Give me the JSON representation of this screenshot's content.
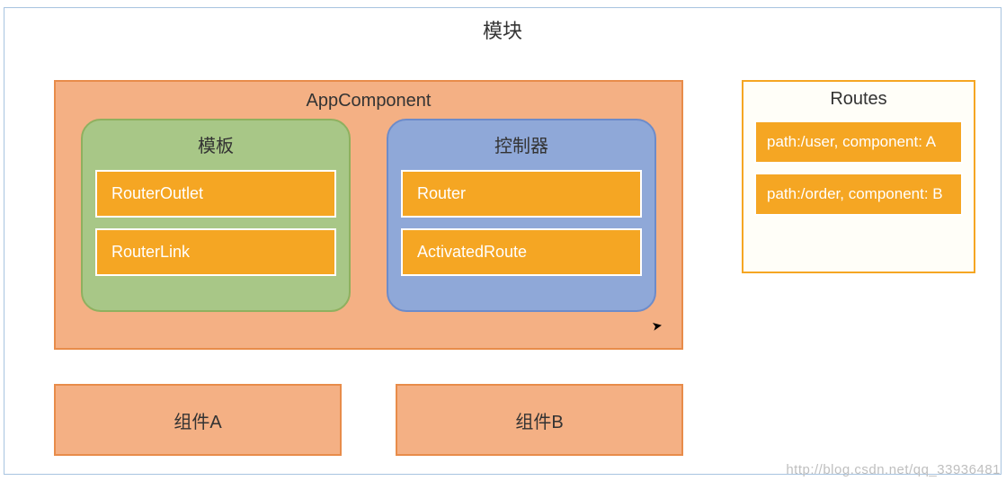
{
  "module": {
    "title": "模块"
  },
  "appComponent": {
    "title": "AppComponent",
    "template": {
      "title": "模板",
      "items": [
        "RouterOutlet",
        "RouterLink"
      ]
    },
    "controller": {
      "title": "控制器",
      "items": [
        "Router",
        "ActivatedRoute"
      ]
    }
  },
  "routes": {
    "title": "Routes",
    "entries": [
      "path:/user, component: A",
      "path:/order, component: B"
    ]
  },
  "components": {
    "a": "组件A",
    "b": "组件B"
  },
  "watermark": "http://blog.csdn.net/qq_33936481"
}
